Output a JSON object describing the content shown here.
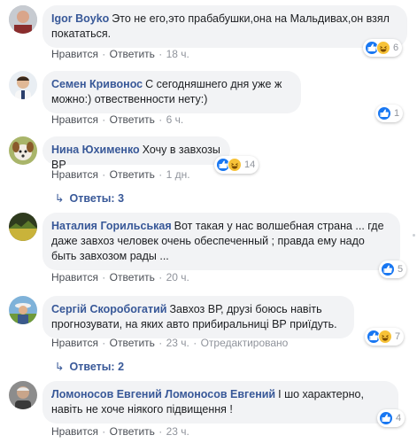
{
  "labels": {
    "like": "Нравится",
    "reply": "Ответить",
    "edited": "Отредактировано",
    "sep": "·"
  },
  "comments": [
    {
      "author": "Igor Boyko",
      "text": "Это не его,это прабабушки,она на Мальдивах,он взял покататься.",
      "time": "18 ч.",
      "reactions": [
        "like",
        "haha"
      ],
      "reaction_count": "6"
    },
    {
      "author": "Семен Кривонос",
      "text": "С сегодняшнего дня уже ж можно:) отвественности нету:)",
      "time": "6 ч.",
      "reactions": [
        "like"
      ],
      "reaction_count": "1"
    },
    {
      "author": "Нина Юхименко",
      "text": "Хочу в завхозы ВР",
      "time": "1 дн.",
      "reactions": [
        "like",
        "haha"
      ],
      "reaction_count": "14",
      "replies_label": "Ответы: 3"
    },
    {
      "author": "Наталия Горильськая",
      "text": "Вот такая у нас волшебная страна ... где даже завхоз человек очень обеспеченный ; правда ему надо быть завхозом рады ...",
      "time": "20 ч.",
      "reactions": [
        "like"
      ],
      "reaction_count": "5"
    },
    {
      "author": "Сергій Скоробогатий",
      "text": "Завхоз ВР, друзі боюсь навіть прогнозувати, на яких авто прибиральниці ВР приїдуть.",
      "time": "23 ч.",
      "edited": true,
      "reactions": [
        "like",
        "haha"
      ],
      "reaction_count": "7",
      "replies_label": "Ответы: 2"
    },
    {
      "author": "Ломоносов Евгений Ломоносов Евгений",
      "text": "І шо характерно, навіть не хоче ніякого підвищення !",
      "time": "23 ч.",
      "reactions": [
        "like"
      ],
      "reaction_count": "4"
    }
  ],
  "colors": {
    "author": "#385898",
    "bubble": "#f2f3f5",
    "like": "#1877f2",
    "haha": "#f7c238"
  }
}
